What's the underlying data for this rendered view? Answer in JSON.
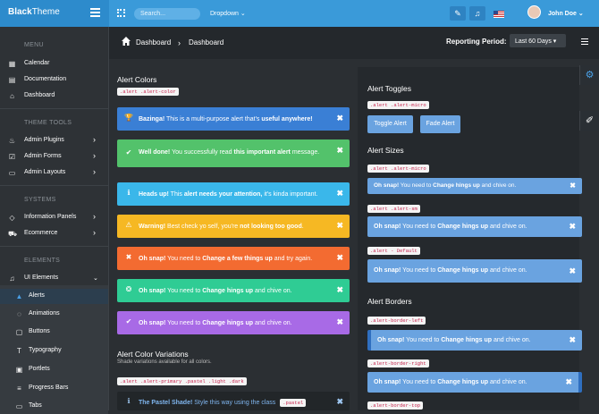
{
  "brand": {
    "bold": "Black",
    "rest": "Theme"
  },
  "topbar": {
    "search_placeholder": "Search...",
    "dropdown_label": "Dropdown ⌄",
    "user_name": "John Doe ⌄"
  },
  "sidebar": {
    "sec_menu": "MENU",
    "sec_theme": "THEME TOOLS",
    "sec_systems": "SYSTEMS",
    "sec_elements": "ELEMENTS",
    "items": [
      "Calendar",
      "Documentation",
      "Dashboard",
      "Admin Plugins",
      "Admin Forms",
      "Admin Layouts",
      "Information Panels",
      "Ecommerce",
      "UI Elements"
    ],
    "subitems": [
      "Alerts",
      "Animations",
      "Buttons",
      "Typography",
      "Portlets",
      "Progress Bars",
      "Tabs"
    ]
  },
  "breadcrumb": {
    "first": "Dashboard",
    "second": "Dashboard",
    "period_label": "Reporting Period:",
    "period_value": "Last 60 Days ▾"
  },
  "left": {
    "title_colors": "Alert Colors",
    "code_colors": ".alert .alert-color",
    "alerts": [
      {
        "icon": "🏆",
        "a": "Bazinga!",
        "b": " This is a multi-purpose alert that's ",
        "c": "useful anywhere!",
        "d": "",
        "color": "#3a7fd5"
      },
      {
        "icon": "✔",
        "a": "Well done!",
        "b": " You successfully read ",
        "c": "this important alert",
        "d": " message.",
        "color": "#53c26b"
      },
      {
        "icon": "ℹ",
        "a": "Heads up!",
        "b": " This ",
        "c": "alert needs your attention,",
        "d": " it's kinda important.",
        "color": "#3ab7ea"
      },
      {
        "icon": "⚠",
        "a": "Warning!",
        "b": " Best check yo self, you're ",
        "c": "not looking too good",
        "d": ".",
        "color": "#f6b823"
      },
      {
        "icon": "✖",
        "a": "Oh snap!",
        "b": " You need to ",
        "c": "Change a few things up",
        "d": " and try again.",
        "color": "#f36b31"
      },
      {
        "icon": "❂",
        "a": "Oh snap!",
        "b": " You need to ",
        "c": "Change hings up",
        "d": " and chive on.",
        "color": "#2fcc94"
      },
      {
        "icon": "✔",
        "a": "Oh snap!",
        "b": " You need to ",
        "c": "Change hings up",
        "d": " and chive on.",
        "color": "#a86ae6"
      }
    ],
    "title_variations": "Alert Color Variations",
    "variations_sub": "Shade variations available for all colors.",
    "code_variations": ".alert .alert-primary .pastel .light .dark",
    "pastel": {
      "a": "The Pastel Shade!",
      "b": " Style this way using the class ",
      "code": ".pastel"
    }
  },
  "right": {
    "title_toggles": "Alert Toggles",
    "code_micro": ".alert .alert-micro",
    "btn_toggle": "Toggle Alert",
    "btn_fade": "Fade Alert",
    "title_sizes": "Alert Sizes",
    "code_micro2": ".alert .alert-micro",
    "code_sm": ".alert .alert-sm",
    "code_default": ".alert - Default",
    "title_borders": "Alert Borders",
    "code_bleft": ".alert-border-left",
    "code_bright": ".alert-border-right",
    "code_btop": ".alert-border-top",
    "msg": {
      "a": "Oh snap!",
      "b": " You need to ",
      "c": "Change hings up",
      "d": " and chive on."
    },
    "close": "✖"
  },
  "colors": {
    "accent": "#3a9ad9",
    "alert_primary": "#6aa3e0"
  }
}
